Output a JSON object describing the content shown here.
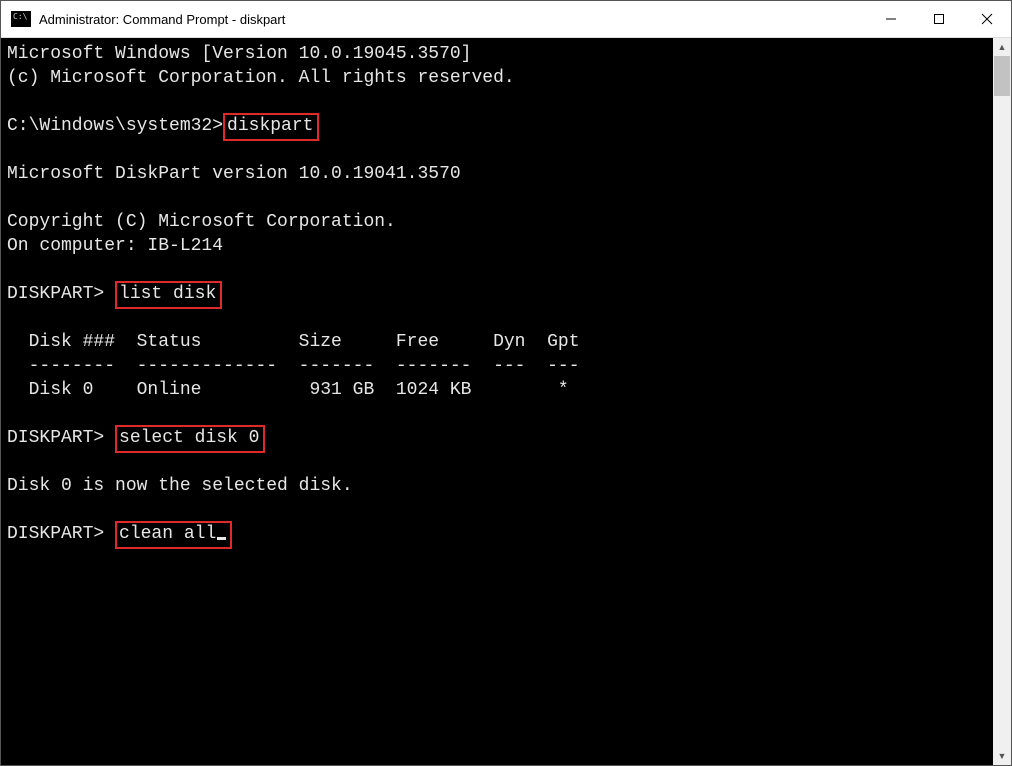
{
  "window": {
    "title": "Administrator: Command Prompt - diskpart"
  },
  "terminal": {
    "line_version": "Microsoft Windows [Version 10.0.19045.3570]",
    "line_copyright": "(c) Microsoft Corporation. All rights reserved.",
    "prompt1_prefix": "C:\\Windows\\system32>",
    "cmd1": "diskpart",
    "line_dp_version": "Microsoft DiskPart version 10.0.19041.3570",
    "line_dp_copy": "Copyright (C) Microsoft Corporation.",
    "line_dp_comp": "On computer: IB-L214",
    "prompt2_prefix": "DISKPART> ",
    "cmd2": "list disk",
    "table_header": "  Disk ###  Status         Size     Free     Dyn  Gpt",
    "table_divider": "  --------  -------------  -------  -------  ---  ---",
    "table_row0": "  Disk 0    Online          931 GB  1024 KB        *",
    "prompt3_prefix": "DISKPART> ",
    "cmd3": "select disk 0",
    "line_selected": "Disk 0 is now the selected disk.",
    "prompt4_prefix": "DISKPART> ",
    "cmd4": "clean all"
  },
  "highlight_color": "#e02a2a"
}
